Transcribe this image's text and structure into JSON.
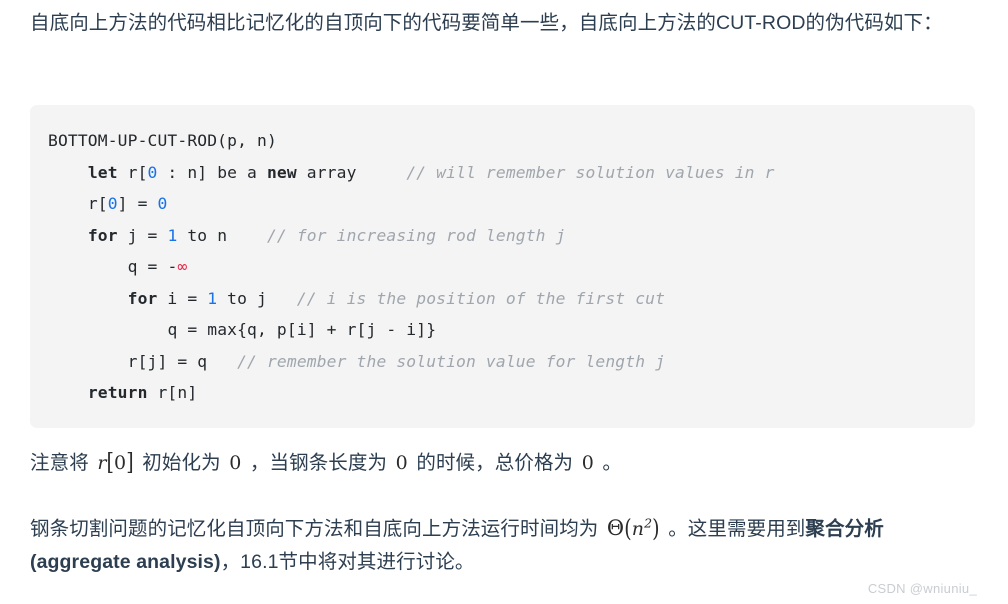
{
  "document": {
    "intro_paragraph": "自底向上方法的代码相比记忆化的自顶向下的代码要简单一些，自底向上方法的CUT-ROD的伪代码如下：",
    "note_paragraph": {
      "seg1": "注意将 ",
      "math_r0": "r[0]",
      "seg2": " 初始化为 ",
      "math_zero_1": "0",
      "seg3": " ，当钢条长度为 ",
      "math_zero_2": "0",
      "seg4": " 的时候，总价格为 ",
      "math_zero_3": "0",
      "seg5": " 。"
    },
    "complexity_paragraph": {
      "seg1": "钢条切割问题的记忆化自顶向下方法和自底向上方法运行时间均为 ",
      "math_theta": "Θ(n²)",
      "math_theta_base": "n",
      "math_theta_exp": "2",
      "math_theta_symbol": "Θ",
      "seg2": " 。这里需要用到",
      "bold1": "聚合分析(aggregate analysis)",
      "seg3": "，16.1节中将对其进行讨论。"
    }
  },
  "code_block": {
    "language": "pseudocode",
    "background_color": "#f4f4f4",
    "keyword_color": "#24292e",
    "number_color": "#1872e8",
    "comment_color": "#a0a6ad",
    "accent_red": "#e6294b",
    "lines": [
      {
        "indent": 0,
        "tokens": [
          {
            "t": "plain",
            "v": "BOTTOM-UP-CUT-ROD(p, n)"
          }
        ]
      },
      {
        "indent": 4,
        "tokens": [
          {
            "t": "kw",
            "v": "let"
          },
          {
            "t": "plain",
            "v": " r["
          },
          {
            "t": "num",
            "v": "0"
          },
          {
            "t": "plain",
            "v": " : n] be a "
          },
          {
            "t": "kw",
            "v": "new"
          },
          {
            "t": "plain",
            "v": " array"
          },
          {
            "t": "plain",
            "v": "     "
          },
          {
            "t": "comment",
            "v": "// will remember solution values in r"
          }
        ]
      },
      {
        "indent": 4,
        "tokens": [
          {
            "t": "plain",
            "v": "r["
          },
          {
            "t": "num",
            "v": "0"
          },
          {
            "t": "plain",
            "v": "] = "
          },
          {
            "t": "num",
            "v": "0"
          }
        ]
      },
      {
        "indent": 4,
        "tokens": [
          {
            "t": "kw",
            "v": "for"
          },
          {
            "t": "plain",
            "v": " j = "
          },
          {
            "t": "num",
            "v": "1"
          },
          {
            "t": "plain",
            "v": " to n"
          },
          {
            "t": "plain",
            "v": "    "
          },
          {
            "t": "comment",
            "v": "// for increasing rod length j"
          }
        ]
      },
      {
        "indent": 8,
        "tokens": [
          {
            "t": "plain",
            "v": "q = "
          },
          {
            "t": "plain",
            "v": "-"
          },
          {
            "t": "red",
            "v": "∞"
          }
        ]
      },
      {
        "indent": 8,
        "tokens": [
          {
            "t": "kw",
            "v": "for"
          },
          {
            "t": "plain",
            "v": " i = "
          },
          {
            "t": "num",
            "v": "1"
          },
          {
            "t": "plain",
            "v": " to j"
          },
          {
            "t": "plain",
            "v": "   "
          },
          {
            "t": "comment",
            "v": "// i is the position of the first cut"
          }
        ]
      },
      {
        "indent": 12,
        "tokens": [
          {
            "t": "plain",
            "v": "q = max{q, p[i] + r[j - i]}"
          }
        ]
      },
      {
        "indent": 8,
        "tokens": [
          {
            "t": "plain",
            "v": "r[j] = q"
          },
          {
            "t": "plain",
            "v": "   "
          },
          {
            "t": "comment",
            "v": "// remember the solution value for length j"
          }
        ]
      },
      {
        "indent": 4,
        "tokens": [
          {
            "t": "kw",
            "v": "return"
          },
          {
            "t": "plain",
            "v": " r[n]"
          }
        ]
      }
    ]
  },
  "watermark": {
    "text": "CSDN @wniuniu_",
    "color": "#c9cdd2"
  }
}
